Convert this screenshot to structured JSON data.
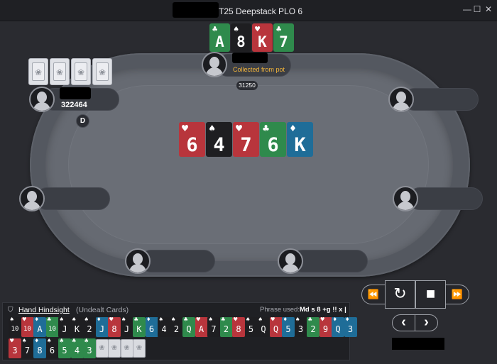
{
  "window": {
    "title": "T25 Deepstack PLO 6",
    "controls": {
      "minimize": "—",
      "maximize": "☐",
      "close": "✕"
    }
  },
  "colors": {
    "red_suit": "#b8353c",
    "black_suit": "#1e1e21",
    "green_suit": "#2f8a4c",
    "blue_suit": "#1f6d98",
    "highlight": "#f2b43a"
  },
  "top_player": {
    "hand": [
      {
        "rank": "A",
        "suit": "♣"
      },
      {
        "rank": "8",
        "suit": "♠"
      },
      {
        "rank": "K",
        "suit": "♥"
      },
      {
        "rank": "7",
        "suit": "♣"
      }
    ],
    "status": "Collected from pot",
    "pot_amount": "31250"
  },
  "left_player": {
    "stack": "322464",
    "dealer_label": "D",
    "back_symbol": "❀"
  },
  "board": [
    {
      "rank": "6",
      "suit": "♥"
    },
    {
      "rank": "4",
      "suit": "♠"
    },
    {
      "rank": "7",
      "suit": "♥"
    },
    {
      "rank": "6",
      "suit": "♣"
    },
    {
      "rank": "K",
      "suit": "♦"
    }
  ],
  "controls": {
    "rewind_icon": "⏪",
    "replay_icon": "↻",
    "stop_icon": "■",
    "forward_icon": "⏩",
    "prev_icon": "‹",
    "next_icon": "›"
  },
  "hindsight": {
    "title": "Hand Hindsight",
    "subtitle": "(Undealt Cards)",
    "phrase_label": "Phrase used:",
    "phrase_value": "Md s 8 +g !! x |",
    "cards": [
      {
        "rank": "10",
        "suit": "♠"
      },
      {
        "rank": "10",
        "suit": "♥"
      },
      {
        "rank": "A",
        "suit": "♦"
      },
      {
        "rank": "10",
        "suit": "♣"
      },
      {
        "rank": "J",
        "suit": "♠"
      },
      {
        "rank": "K",
        "suit": "♠"
      },
      {
        "rank": "2",
        "suit": "♠"
      },
      {
        "rank": "J",
        "suit": "♦"
      },
      {
        "rank": "8",
        "suit": "♥"
      },
      {
        "rank": "J",
        "suit": "♠"
      },
      {
        "rank": "K",
        "suit": "♣"
      },
      {
        "rank": "6",
        "suit": "♦"
      },
      {
        "rank": "4",
        "suit": "♠"
      },
      {
        "rank": "2",
        "suit": "♠"
      },
      {
        "rank": "Q",
        "suit": "♣"
      },
      {
        "rank": "A",
        "suit": "♥"
      },
      {
        "rank": "7",
        "suit": "♠"
      },
      {
        "rank": "2",
        "suit": "♣"
      },
      {
        "rank": "8",
        "suit": "♥"
      },
      {
        "rank": "5",
        "suit": "♠"
      },
      {
        "rank": "Q",
        "suit": "♠"
      },
      {
        "rank": "Q",
        "suit": "♥"
      },
      {
        "rank": "5",
        "suit": "♦"
      },
      {
        "rank": "3",
        "suit": "♠"
      },
      {
        "rank": "2",
        "suit": "♣"
      },
      {
        "rank": "9",
        "suit": "♥"
      },
      {
        "rank": "Q",
        "suit": "♦"
      },
      {
        "rank": "3",
        "suit": "♦"
      },
      {
        "rank": "3",
        "suit": "♥"
      },
      {
        "rank": "7",
        "suit": "♠"
      },
      {
        "rank": "8",
        "suit": "♦"
      },
      {
        "rank": "6",
        "suit": "♠"
      },
      {
        "rank": "5",
        "suit": "♣"
      },
      {
        "rank": "4",
        "suit": "♣"
      },
      {
        "rank": "3",
        "suit": "♣"
      }
    ],
    "back_symbol": "❀"
  }
}
